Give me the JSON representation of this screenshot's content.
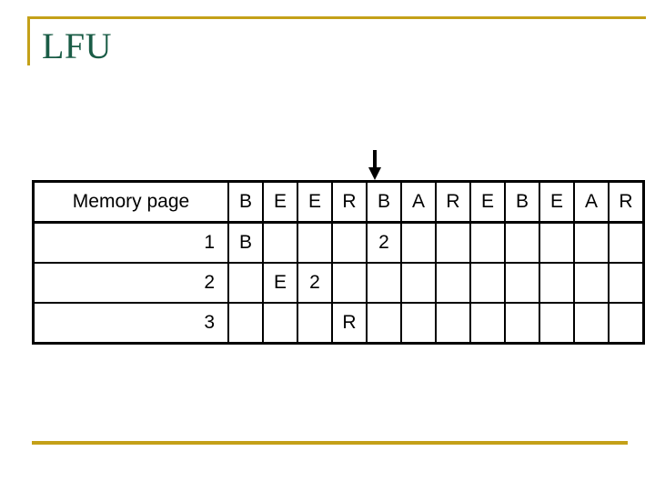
{
  "slide": {
    "title": "LFU"
  },
  "theme": {
    "accent_rule_color": "#c4a018",
    "title_color": "#1a5c46",
    "table_border_color": "#000000",
    "page_letter_color": "#c795e0",
    "frequency_count_color": "#aa2222",
    "background_color": "#ffffff"
  },
  "pointer": {
    "icon": "arrow-down-icon",
    "points_at_column_index": 4,
    "points_at_reference": "B"
  },
  "table": {
    "corner_header": "Memory page",
    "reference_string": [
      "B",
      "E",
      "E",
      "R",
      "B",
      "A",
      "R",
      "E",
      "B",
      "E",
      "A",
      "R"
    ],
    "rows": [
      {
        "label": "1",
        "cells": [
          {
            "text": "B",
            "kind": "page"
          },
          {
            "text": "",
            "kind": "empty"
          },
          {
            "text": "",
            "kind": "empty"
          },
          {
            "text": "",
            "kind": "empty"
          },
          {
            "text": "2",
            "kind": "count"
          },
          {
            "text": "",
            "kind": "empty"
          },
          {
            "text": "",
            "kind": "empty"
          },
          {
            "text": "",
            "kind": "empty"
          },
          {
            "text": "",
            "kind": "empty"
          },
          {
            "text": "",
            "kind": "empty"
          },
          {
            "text": "",
            "kind": "empty"
          },
          {
            "text": "",
            "kind": "empty"
          }
        ]
      },
      {
        "label": "2",
        "cells": [
          {
            "text": "",
            "kind": "empty"
          },
          {
            "text": "E",
            "kind": "page"
          },
          {
            "text": "2",
            "kind": "count"
          },
          {
            "text": "",
            "kind": "empty"
          },
          {
            "text": "",
            "kind": "empty"
          },
          {
            "text": "",
            "kind": "empty"
          },
          {
            "text": "",
            "kind": "empty"
          },
          {
            "text": "",
            "kind": "empty"
          },
          {
            "text": "",
            "kind": "empty"
          },
          {
            "text": "",
            "kind": "empty"
          },
          {
            "text": "",
            "kind": "empty"
          },
          {
            "text": "",
            "kind": "empty"
          }
        ]
      },
      {
        "label": "3",
        "cells": [
          {
            "text": "",
            "kind": "empty"
          },
          {
            "text": "",
            "kind": "empty"
          },
          {
            "text": "",
            "kind": "empty"
          },
          {
            "text": "R",
            "kind": "page"
          },
          {
            "text": "",
            "kind": "empty"
          },
          {
            "text": "",
            "kind": "empty"
          },
          {
            "text": "",
            "kind": "empty"
          },
          {
            "text": "",
            "kind": "empty"
          },
          {
            "text": "",
            "kind": "empty"
          },
          {
            "text": "",
            "kind": "empty"
          },
          {
            "text": "",
            "kind": "empty"
          },
          {
            "text": "",
            "kind": "empty"
          }
        ]
      }
    ]
  }
}
